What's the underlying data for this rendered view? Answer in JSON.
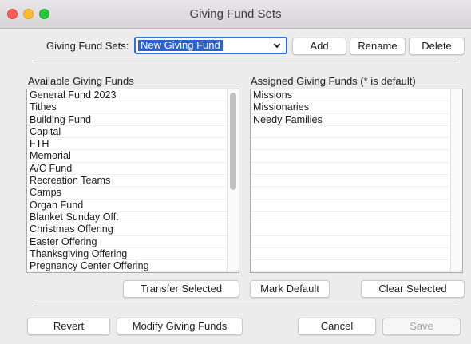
{
  "window": {
    "title": "Giving Fund Sets"
  },
  "header": {
    "sets_label": "Giving Fund Sets:",
    "selected_set": "New Giving Fund",
    "add_label": "Add",
    "rename_label": "Rename",
    "delete_label": "Delete"
  },
  "available": {
    "header": "Available Giving Funds",
    "items": [
      "General Fund 2023",
      "Tithes",
      "Building Fund",
      "Capital",
      "FTH",
      "Memorial",
      "A/C Fund",
      "Recreation Teams",
      "Camps",
      "Organ Fund",
      "Blanket Sunday Off.",
      "Christmas Offering",
      "Easter Offering",
      "Thanksgiving Offering",
      "Pregnancy Center Offering"
    ]
  },
  "assigned": {
    "header": "Assigned Giving Funds (* is default)",
    "items": [
      "Missions",
      "Missionaries",
      "Needy Families"
    ]
  },
  "actions": {
    "transfer_label": "Transfer Selected",
    "mark_default_label": "Mark Default",
    "clear_selected_label": "Clear Selected"
  },
  "footer": {
    "revert_label": "Revert",
    "modify_label": "Modify Giving Funds",
    "cancel_label": "Cancel",
    "save_label": "Save"
  }
}
